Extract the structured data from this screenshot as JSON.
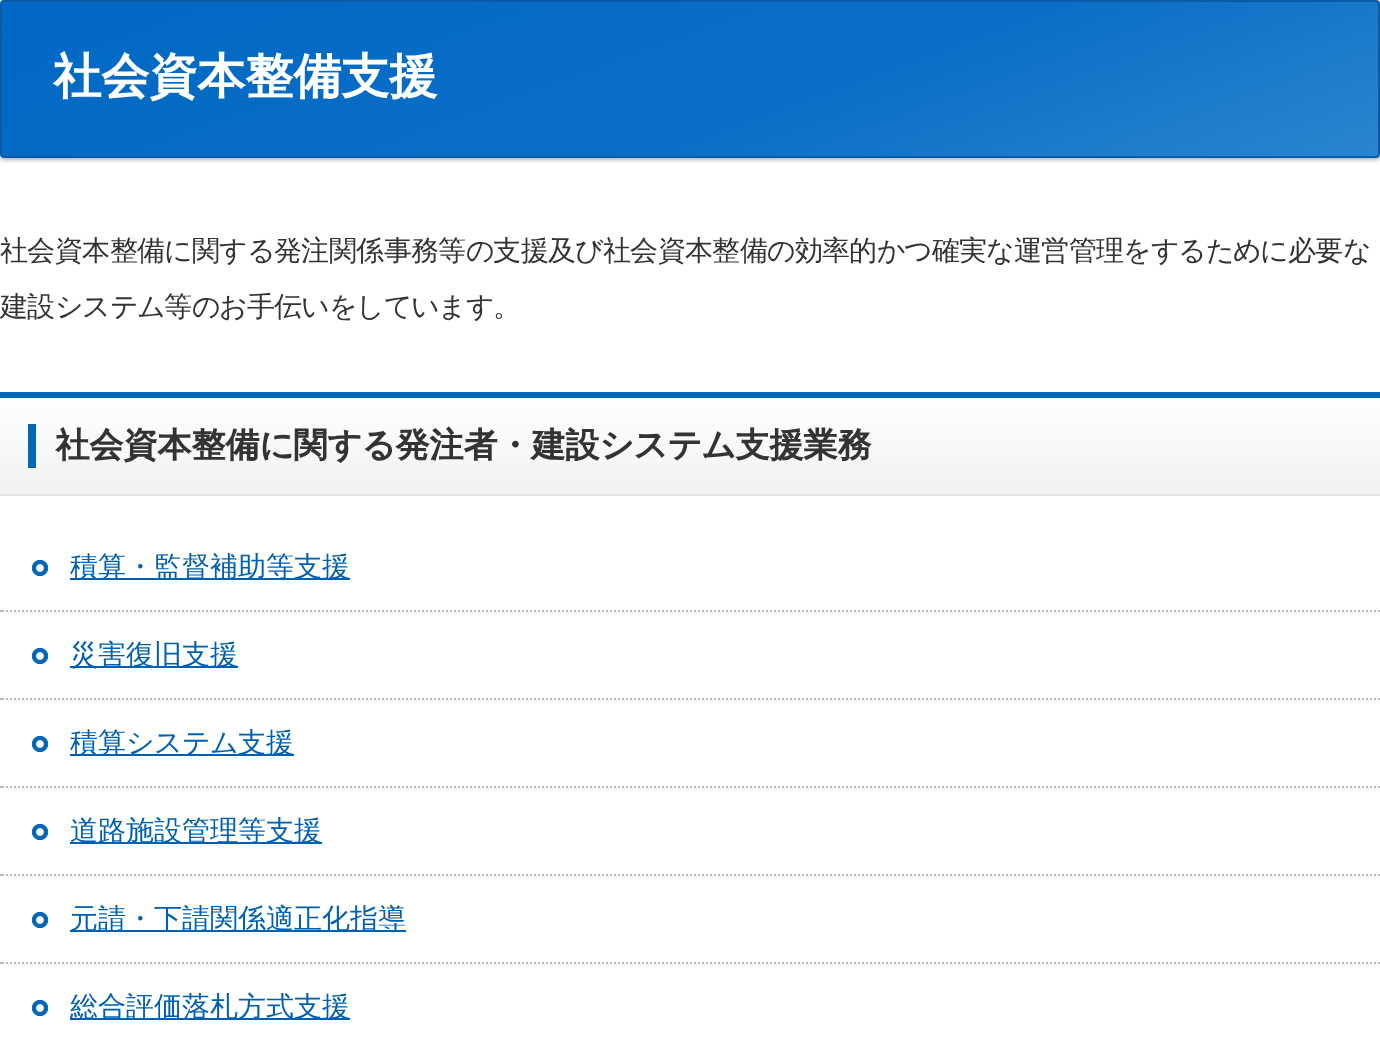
{
  "page_title": "社会資本整備支援",
  "intro": "社会資本整備に関する発注関係事務等の支援及び社会資本整備の効率的かつ確実な運営管理をするために必要な建設システム等のお手伝いをしています。",
  "section": {
    "heading": "社会資本整備に関する発注者・建設システム支援業務",
    "links": [
      "積算・監督補助等支援",
      "災害復旧支援",
      "積算システム支援",
      "道路施設管理等支援",
      "元請・下請関係適正化指導",
      "総合評価落札方式支援"
    ]
  }
}
